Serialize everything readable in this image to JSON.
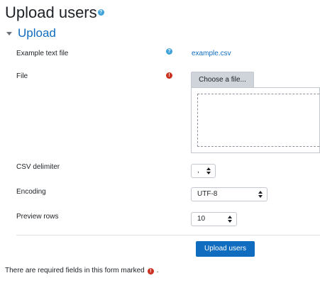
{
  "page": {
    "title": "Upload users",
    "title_help_icon": "question-icon"
  },
  "section": {
    "label": "Upload",
    "toggle_icon": "caret-down-icon"
  },
  "form": {
    "example_text_file": {
      "label": "Example text file",
      "help_icon": "question-icon",
      "link_text": "example.csv"
    },
    "file": {
      "label": "File",
      "required_icon": "exclamation-icon",
      "choose_button": "Choose a file..."
    },
    "csv_delimiter": {
      "label": "CSV delimiter",
      "value": ","
    },
    "encoding": {
      "label": "Encoding",
      "value": "UTF-8"
    },
    "preview_rows": {
      "label": "Preview rows",
      "value": "10"
    },
    "submit_label": "Upload users"
  },
  "footer": {
    "required_note": "There are required fields in this form marked",
    "required_note_end": "."
  },
  "colors": {
    "link": "#0f6cbf",
    "primary": "#0f6cbf",
    "help": "#3fa2da",
    "required": "#ca3120"
  }
}
